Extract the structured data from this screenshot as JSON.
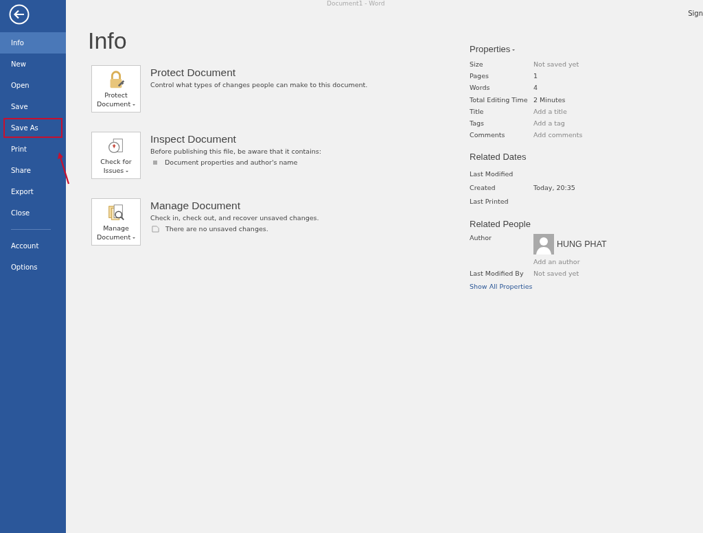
{
  "window": {
    "title": "Document1 - Word",
    "account_link": "Sign"
  },
  "sidebar": {
    "items": [
      {
        "label": "Info",
        "selected": true,
        "outlined": false
      },
      {
        "label": "New",
        "selected": false,
        "outlined": false
      },
      {
        "label": "Open",
        "selected": false,
        "outlined": false
      },
      {
        "label": "Save",
        "selected": false,
        "outlined": false
      },
      {
        "label": "Save As",
        "selected": false,
        "outlined": true
      },
      {
        "label": "Print",
        "selected": false,
        "outlined": false
      },
      {
        "label": "Share",
        "selected": false,
        "outlined": false
      },
      {
        "label": "Export",
        "selected": false,
        "outlined": false
      },
      {
        "label": "Close",
        "selected": false,
        "outlined": false
      },
      {
        "label": "Account",
        "selected": false,
        "outlined": false,
        "separated": true
      },
      {
        "label": "Options",
        "selected": false,
        "outlined": false
      }
    ]
  },
  "page_title": "Info",
  "sections": [
    {
      "kind": "lock",
      "button": [
        "Protect",
        "Document"
      ],
      "title": "Protect Document",
      "description": "Control what types of changes people can make to this document."
    },
    {
      "kind": "inspect",
      "button": [
        "Check for",
        "Issues"
      ],
      "title": "Inspect Document",
      "description": "Before publishing this file, be aware that it contains:",
      "bullet": {
        "kind": "square",
        "text": "Document properties and author's name"
      }
    },
    {
      "kind": "manage",
      "button": [
        "Manage",
        "Document"
      ],
      "title": "Manage Document",
      "description": "Check in, check out, and recover unsaved changes.",
      "bullet": {
        "kind": "page",
        "text": "There are no unsaved changes."
      }
    }
  ],
  "properties": {
    "heading": "Properties",
    "rows": [
      {
        "label": "Size",
        "value": "Not saved yet",
        "muted": true
      },
      {
        "label": "Pages",
        "value": "1",
        "muted": false
      },
      {
        "label": "Words",
        "value": "4",
        "muted": false
      },
      {
        "label": "Total Editing Time",
        "value": "2 Minutes",
        "muted": false
      },
      {
        "label": "Title",
        "value": "Add a title",
        "muted": true
      },
      {
        "label": "Tags",
        "value": "Add a tag",
        "muted": true
      },
      {
        "label": "Comments",
        "value": "Add comments",
        "muted": true
      }
    ]
  },
  "related_dates": {
    "heading": "Related Dates",
    "rows": [
      {
        "label": "Last Modified"
      },
      {
        "label": "Created",
        "value": "Today, 20:35",
        "muted": false
      },
      {
        "label": "Last Printed"
      }
    ]
  },
  "related_people": {
    "heading": "Related People",
    "author_label": "Author",
    "author_name": "HUNG PHAT",
    "add_author": "Add an author",
    "last_modified_label": "Last Modified By",
    "last_modified_value": "Not saved yet"
  },
  "show_all_link": "Show All Properties"
}
